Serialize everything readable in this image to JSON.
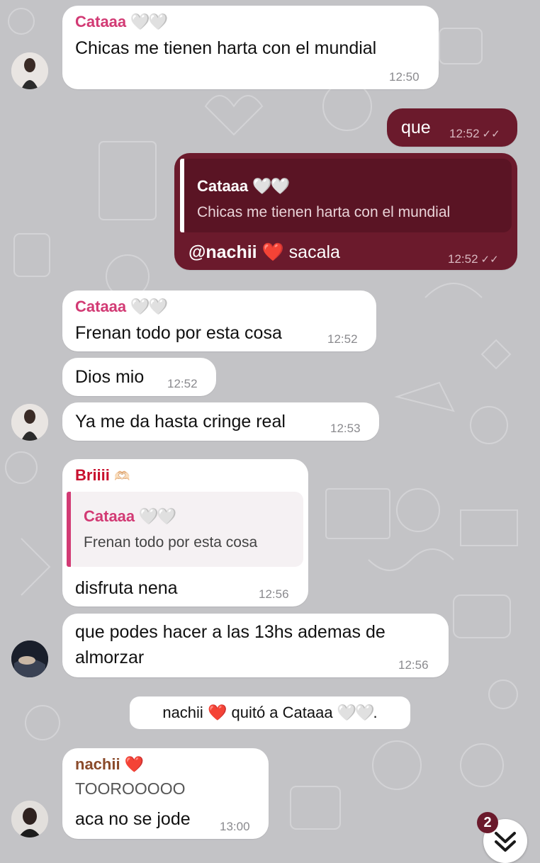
{
  "colors": {
    "background": "#c3c3c6",
    "outgoing_bubble": "#6b1a2c",
    "incoming_bubble": "#ffffff",
    "name_cataaa": "#d23a74",
    "name_briiii": "#c8102e",
    "name_nachii": "#8a4a2a"
  },
  "messages": [
    {
      "sender": "Cataaa",
      "sender_emoji": "🤍🤍",
      "text": "Chicas me tienen harta con el mundial",
      "time": "12:50"
    },
    {
      "text": "que",
      "time": "12:52",
      "status_icon": "double-check-icon"
    },
    {
      "reply_sender": "Cataaa",
      "reply_sender_emoji": "🤍🤍",
      "reply_text": "Chicas me tienen harta con el mundial",
      "mention": "@nachii",
      "mention_emoji": "❤️",
      "text": "sacala",
      "time": "12:52",
      "status_icon": "double-check-icon"
    },
    {
      "sender": "Cataaa",
      "sender_emoji": "🤍🤍",
      "text": "Frenan todo por esta cosa",
      "time": "12:52"
    },
    {
      "text": "Dios mio",
      "time": "12:52"
    },
    {
      "text": "Ya me da hasta cringe real",
      "time": "12:53"
    },
    {
      "sender": "Briiii",
      "sender_emoji": "🫶🏻",
      "reply_sender": "Cataaa",
      "reply_sender_emoji": "🤍🤍",
      "reply_text": "Frenan todo por esta cosa",
      "text": "disfruta nena",
      "time": "12:56"
    },
    {
      "text_line1": "que podes hacer a las 13hs ademas de",
      "text_line2": "almorzar",
      "time": "12:56"
    },
    {
      "sender": "nachii",
      "sender_emoji": "❤️",
      "text_line1": "TOOROOOOO",
      "text_line2": "aca no se jode",
      "time": "13:00"
    }
  ],
  "service_message": {
    "actor": "nachii",
    "actor_emoji": "❤️",
    "action": "quitó a",
    "target": "Cataaa",
    "target_emoji": "🤍🤍",
    "end": "."
  },
  "scroll_button": {
    "badge_count": "2",
    "icon": "chevron-double-down-icon"
  }
}
